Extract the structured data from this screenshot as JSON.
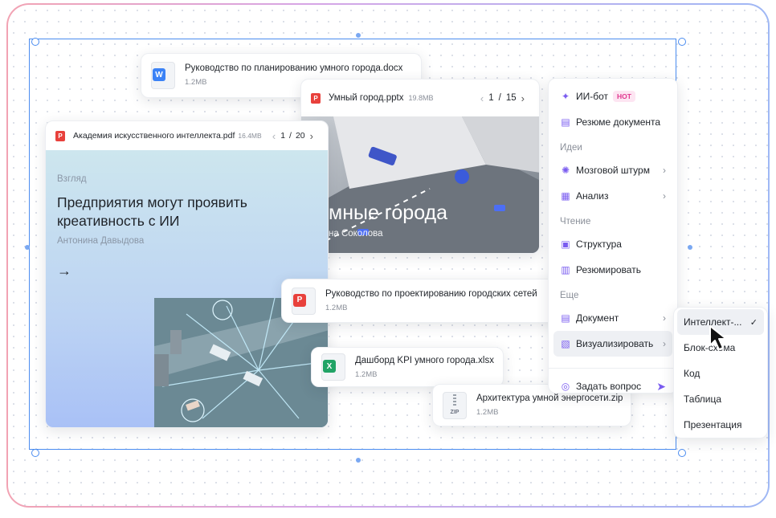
{
  "files": {
    "docx": {
      "name": "Руководство по планированию умного города.docx",
      "size": "1.2MB",
      "icon": "word-file-icon",
      "badge": "W",
      "color": "#3b82f6"
    },
    "pdf_design": {
      "name": "Руководство по проектированию городских сетей",
      "size": "1.2MB",
      "icon": "pdf-file-icon",
      "color": "#e8413c"
    },
    "xlsx": {
      "name": "Дашборд KPI умного города.xlsx",
      "size": "1.2MB",
      "icon": "excel-file-icon",
      "badge": "X",
      "color": "#21a366"
    },
    "zip": {
      "name": "Архитектура умной энергосети.zip",
      "size": "1.2MB",
      "icon": "zip-file-icon",
      "badge": "ZIP"
    }
  },
  "pptx_viewer": {
    "title": "Умный город.pptx",
    "size": "19.8MB",
    "page": "1",
    "sep": "/",
    "total": "15",
    "slide_title": "мные города",
    "slide_author": "на Соколова"
  },
  "pdf_viewer": {
    "title": "Академия искусственного интеллекта.pdf",
    "size": "16.4MB",
    "page": "1",
    "sep": "/",
    "total": "20",
    "kicker": "Взгляд",
    "heading": "Предприятия могут проявить креативность с  ИИ",
    "author": "Антонина Давыдова",
    "arrow": "→"
  },
  "menu": {
    "ai_bot": "ИИ-бот",
    "hot": "HOT",
    "summary": "Резюме документа",
    "section_ideas": "Идеи",
    "brainstorm": "Мозговой штурм",
    "analysis": "Анализ",
    "section_reading": "Чтение",
    "structure": "Структура",
    "summarize": "Резюмировать",
    "section_more": "Еще",
    "document": "Документ",
    "visualize": "Визуализировать",
    "ask": "Задать вопрос"
  },
  "submenu": {
    "items": [
      "Интеллект-...",
      "Блок-схема",
      "Код",
      "Таблица",
      "Презентация"
    ],
    "selected_mark": "✓"
  },
  "colors": {
    "accent": "#7a5cf0",
    "selection": "#4a8cf0"
  }
}
